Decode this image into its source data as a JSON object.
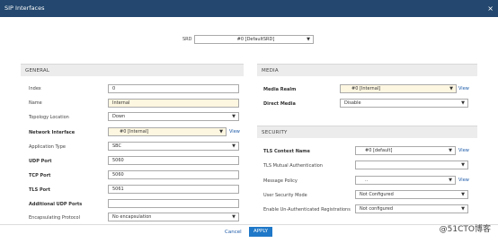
{
  "window": {
    "title": "SIP Interfaces",
    "close_glyph": "×"
  },
  "srd": {
    "label": "SRD",
    "value": "#0 [DefaultSRD]"
  },
  "general": {
    "heading": "GENERAL",
    "fields": {
      "index": {
        "label": "Index",
        "value": "0"
      },
      "name": {
        "label": "Name",
        "value": "Internal"
      },
      "topology_location": {
        "label": "Topology Location",
        "value": "Down"
      },
      "network_interface": {
        "label": "Network Interface",
        "value": "#0 [Internal]",
        "link": "View"
      },
      "application_type": {
        "label": "Application Type",
        "value": "SBC"
      },
      "udp_port": {
        "label": "UDP Port",
        "value": "5060"
      },
      "tcp_port": {
        "label": "TCP Port",
        "value": "5060"
      },
      "tls_port": {
        "label": "TLS Port",
        "value": "5061"
      },
      "additional_udp_ports": {
        "label": "Additional UDP Ports",
        "value": ""
      },
      "encapsulating_protocol": {
        "label": "Encapsulating Protocol",
        "value": "No encapsulation"
      }
    }
  },
  "media": {
    "heading": "MEDIA",
    "fields": {
      "media_realm": {
        "label": "Media Realm",
        "value": "#0 [Internal]",
        "link": "View"
      },
      "direct_media": {
        "label": "Direct Media",
        "value": "Disable"
      }
    }
  },
  "security": {
    "heading": "SECURITY",
    "fields": {
      "tls_context_name": {
        "label": "TLS Context Name",
        "value": "#0 [default]",
        "link": "View"
      },
      "tls_mutual_auth": {
        "label": "TLS Mutual Authentication",
        "value": ""
      },
      "message_policy": {
        "label": "Message Policy",
        "value": "..",
        "link": "View"
      },
      "user_security_mode": {
        "label": "User Security Mode",
        "value": "Not Configured"
      },
      "enable_unauth_reg": {
        "label": "Enable Un-Authenticated Registrations",
        "value": "Not configured"
      }
    }
  },
  "footer": {
    "cancel": "Cancel",
    "apply": "APPLY"
  },
  "watermark": "@51CTO博客",
  "colors": {
    "titlebar": "#23476e",
    "apply": "#1f78c8",
    "link": "#1d5aa8",
    "highlight": "#fdf6e0"
  }
}
